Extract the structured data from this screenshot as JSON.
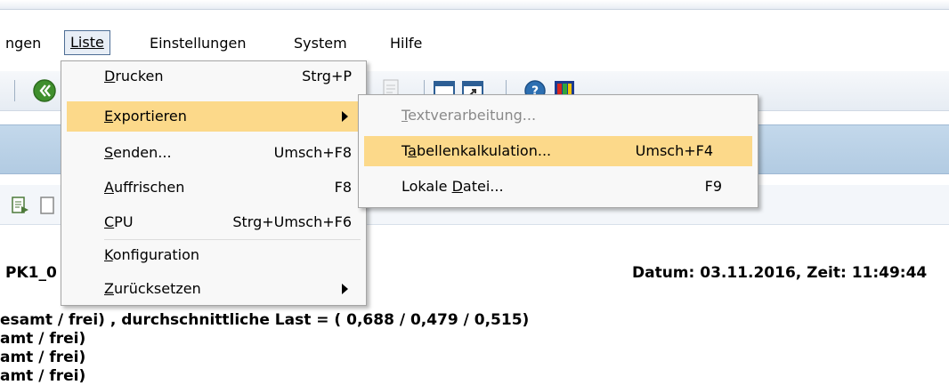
{
  "menubar": {
    "items": [
      {
        "label": "ngen"
      },
      {
        "label": "Liste"
      },
      {
        "label": "Einstellungen"
      },
      {
        "label": "System"
      },
      {
        "label": "Hilfe"
      }
    ]
  },
  "liste_menu": {
    "items": [
      {
        "pre": "",
        "u": "D",
        "post": "rucken",
        "shortcut": "Strg+P"
      },
      {
        "pre": "",
        "u": "E",
        "post": "xportieren",
        "shortcut": ""
      },
      {
        "pre": "",
        "u": "S",
        "post": "enden...",
        "shortcut": "Umsch+F8"
      },
      {
        "pre": "",
        "u": "A",
        "post": "uffrischen",
        "shortcut": "F8"
      },
      {
        "pre": "",
        "u": "C",
        "post": "PU",
        "shortcut": "Strg+Umsch+F6"
      },
      {
        "pre": "",
        "u": "K",
        "post": "onfiguration",
        "shortcut": ""
      },
      {
        "pre": "",
        "u": "Z",
        "post": "urücksetzen",
        "shortcut": ""
      }
    ]
  },
  "export_menu": {
    "items": [
      {
        "pre": "",
        "u": "T",
        "post": "extverarbeitung...",
        "shortcut": ""
      },
      {
        "pre": "T",
        "u": "a",
        "post": "bellenkalkulation...",
        "shortcut": "Umsch+F4"
      },
      {
        "pre": "Lokale ",
        "u": "D",
        "post": "atei...",
        "shortcut": "F9"
      }
    ]
  },
  "content": {
    "id_fragment": "PK1_0",
    "datetime": "Datum: 03.11.2016, Zeit: 11:49:44",
    "line1": "esamt / frei) , durchschnittliche Last = ( 0,688 / 0,479 / 0,515)",
    "line2": "amt / frei)",
    "line3": "amt / frei)",
    "line4": "amt / frei)"
  },
  "colors": {
    "highlight": "#fcd98a",
    "title_band": "#b9d0e6"
  }
}
